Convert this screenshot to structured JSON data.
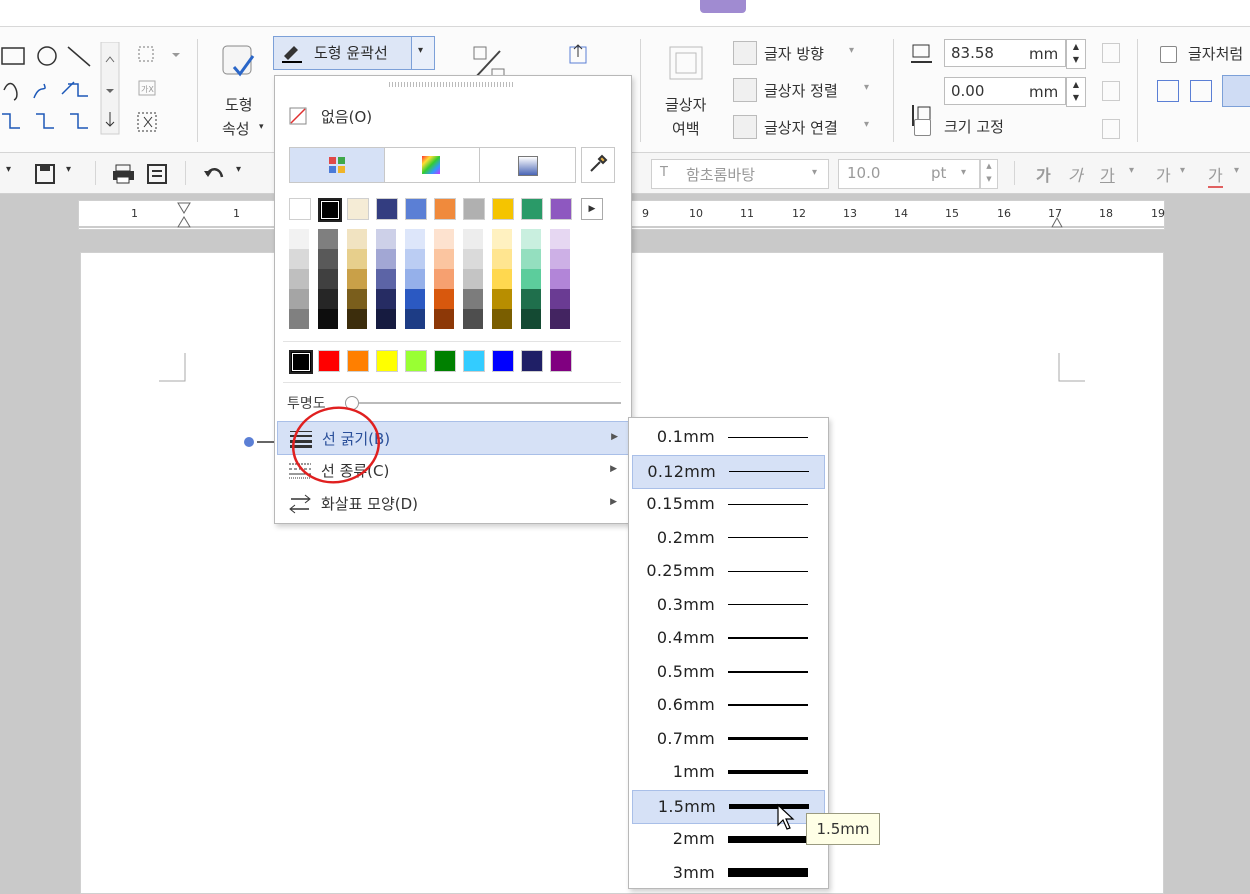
{
  "ribbon": {
    "shape_props_label_1": "도형",
    "shape_props_label_2": "속성",
    "outline_button_label": "도형 윤곽선",
    "textbox_margin_label_1": "글상자",
    "textbox_margin_label_2": "여백",
    "text_direction": "글자 방향",
    "text_align": "글상자 정렬",
    "text_link": "글상자 연결",
    "width_value": "83.58",
    "height_value": "0.00",
    "unit": "mm",
    "fix_size": "크기 고정",
    "text_wrap": "글자처럼"
  },
  "toolbar2": {
    "font_name": "함초롬바탕",
    "font_size": "10.0",
    "font_unit": "pt",
    "format_buttons": [
      "가",
      "가",
      "가",
      "가",
      "가"
    ]
  },
  "ruler": {
    "numbers": [
      "1",
      "1",
      "9",
      "10",
      "11",
      "12",
      "13",
      "14",
      "15",
      "16",
      "17",
      "18",
      "19"
    ]
  },
  "menu": {
    "none_label": "없음(O)",
    "tabs": [
      "standard",
      "spectrum",
      "gradient"
    ],
    "basic_colors": [
      "#ffffff",
      "#000000",
      "#f5ecd6",
      "#333d80",
      "#5b7fd5",
      "#f08a3c",
      "#b0b0b0",
      "#f5c400",
      "#2a9a68",
      "#8e58c0"
    ],
    "shade_columns": [
      [
        "#f2f2f2",
        "#d9d9d9",
        "#bfbfbf",
        "#a5a5a5",
        "#808080"
      ],
      [
        "#7f7f7f",
        "#595959",
        "#404040",
        "#262626",
        "#0d0d0d"
      ],
      [
        "#f1e3c1",
        "#e7cf8c",
        "#c9a048",
        "#7a5e1c",
        "#3c2d0c"
      ],
      [
        "#cdd0e8",
        "#a2a7d4",
        "#5c64a6",
        "#262c63",
        "#161b40"
      ],
      [
        "#dde6fa",
        "#bbcdf3",
        "#95b0ea",
        "#2b59c2",
        "#1d3c85"
      ],
      [
        "#fde2cf",
        "#fbc5a0",
        "#f6a070",
        "#d8580d",
        "#8d3807"
      ],
      [
        "#ededed",
        "#dadada",
        "#c4c4c4",
        "#7c7c7c",
        "#4e4e4e"
      ],
      [
        "#fff1c0",
        "#ffe590",
        "#ffd84f",
        "#b88e00",
        "#7a5e00"
      ],
      [
        "#c9efdf",
        "#94dfbf",
        "#5ccd9c",
        "#1f6f4c",
        "#144a33"
      ],
      [
        "#e6d7f2",
        "#cdb0e6",
        "#b285d8",
        "#6a3b93",
        "#432461"
      ]
    ],
    "standard_colors": [
      "#000000",
      "#ff0000",
      "#ff7f00",
      "#ffff00",
      "#99ff33",
      "#008000",
      "#33ccff",
      "#0000ff",
      "#1f1f66",
      "#800080"
    ],
    "transparency_label": "투명도",
    "items": [
      {
        "label": "선 굵기(B)"
      },
      {
        "label": "선 종류(C)"
      },
      {
        "label": "화살표 모양(D)"
      }
    ]
  },
  "submenu": {
    "items": [
      {
        "label": "0.1mm",
        "weight": 1
      },
      {
        "label": "0.12mm",
        "weight": 1
      },
      {
        "label": "0.15mm",
        "weight": 1
      },
      {
        "label": "0.2mm",
        "weight": 1
      },
      {
        "label": "0.25mm",
        "weight": 1
      },
      {
        "label": "0.3mm",
        "weight": 1.5
      },
      {
        "label": "0.4mm",
        "weight": 2
      },
      {
        "label": "0.5mm",
        "weight": 2
      },
      {
        "label": "0.6mm",
        "weight": 2.5
      },
      {
        "label": "0.7mm",
        "weight": 3
      },
      {
        "label": "1mm",
        "weight": 4
      },
      {
        "label": "1.5mm",
        "weight": 5
      },
      {
        "label": "2mm",
        "weight": 7
      },
      {
        "label": "3mm",
        "weight": 9
      }
    ],
    "highlighted": [
      "0.12mm",
      "1.5mm"
    ]
  },
  "tooltip": {
    "text": "1.5mm"
  }
}
